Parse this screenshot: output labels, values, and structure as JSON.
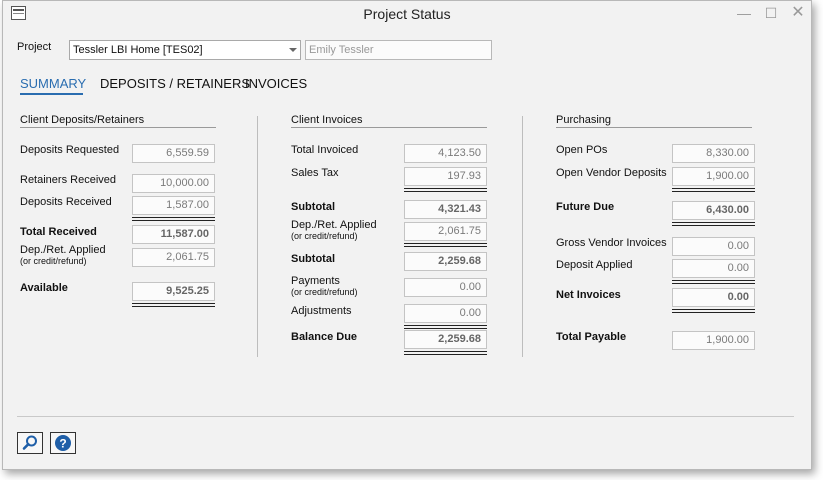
{
  "window": {
    "title": "Project Status"
  },
  "project": {
    "label": "Project",
    "selected": "Tessler LBI Home [TES02]",
    "client_name": "Emily Tessler"
  },
  "tabs": [
    {
      "label": "SUMMARY"
    },
    {
      "label": "DEPOSITS / RETAINERS"
    },
    {
      "label": "INVOICES"
    }
  ],
  "client_deposits": {
    "header": "Client Deposits/Retainers",
    "deposits_requested": {
      "label": "Deposits Requested",
      "value": "6,559.59"
    },
    "retainers_received": {
      "label": "Retainers Received",
      "value": "10,000.00"
    },
    "deposits_received": {
      "label": "Deposits Received",
      "value": "1,587.00"
    },
    "total_received": {
      "label": "Total Received",
      "value": "11,587.00"
    },
    "dep_ret_applied": {
      "label": "Dep./Ret. Applied",
      "sub": "(or credit/refund)",
      "value": "2,061.75"
    },
    "available": {
      "label": "Available",
      "value": "9,525.25"
    }
  },
  "client_invoices": {
    "header": "Client Invoices",
    "total_invoiced": {
      "label": "Total Invoiced",
      "value": "4,123.50"
    },
    "sales_tax": {
      "label": "Sales Tax",
      "value": "197.93"
    },
    "subtotal1": {
      "label": "Subtotal",
      "value": "4,321.43"
    },
    "dep_ret_applied": {
      "label": "Dep./Ret. Applied",
      "sub": "(or credit/refund)",
      "value": "2,061.75"
    },
    "subtotal2": {
      "label": "Subtotal",
      "value": "2,259.68"
    },
    "payments": {
      "label": "Payments",
      "sub": "(or credit/refund)",
      "value": "0.00"
    },
    "adjustments": {
      "label": "Adjustments",
      "value": "0.00"
    },
    "balance_due": {
      "label": "Balance Due",
      "value": "2,259.68"
    }
  },
  "purchasing": {
    "header": "Purchasing",
    "open_pos": {
      "label": "Open POs",
      "value": "8,330.00"
    },
    "open_vendor_deposits": {
      "label": "Open Vendor Deposits",
      "value": "1,900.00"
    },
    "future_due": {
      "label": "Future Due",
      "value": "6,430.00"
    },
    "gross_vendor_invoices": {
      "label": "Gross Vendor Invoices",
      "value": "0.00"
    },
    "deposit_applied": {
      "label": "Deposit Applied",
      "value": "0.00"
    },
    "net_invoices": {
      "label": "Net Invoices",
      "value": "0.00"
    },
    "total_payable": {
      "label": "Total Payable",
      "value": "1,900.00"
    }
  },
  "footer": {
    "icons": [
      "search-icon",
      "help-icon"
    ]
  },
  "colors": {
    "accent": "#2a6db0",
    "help_blue": "#1f5fa8"
  }
}
